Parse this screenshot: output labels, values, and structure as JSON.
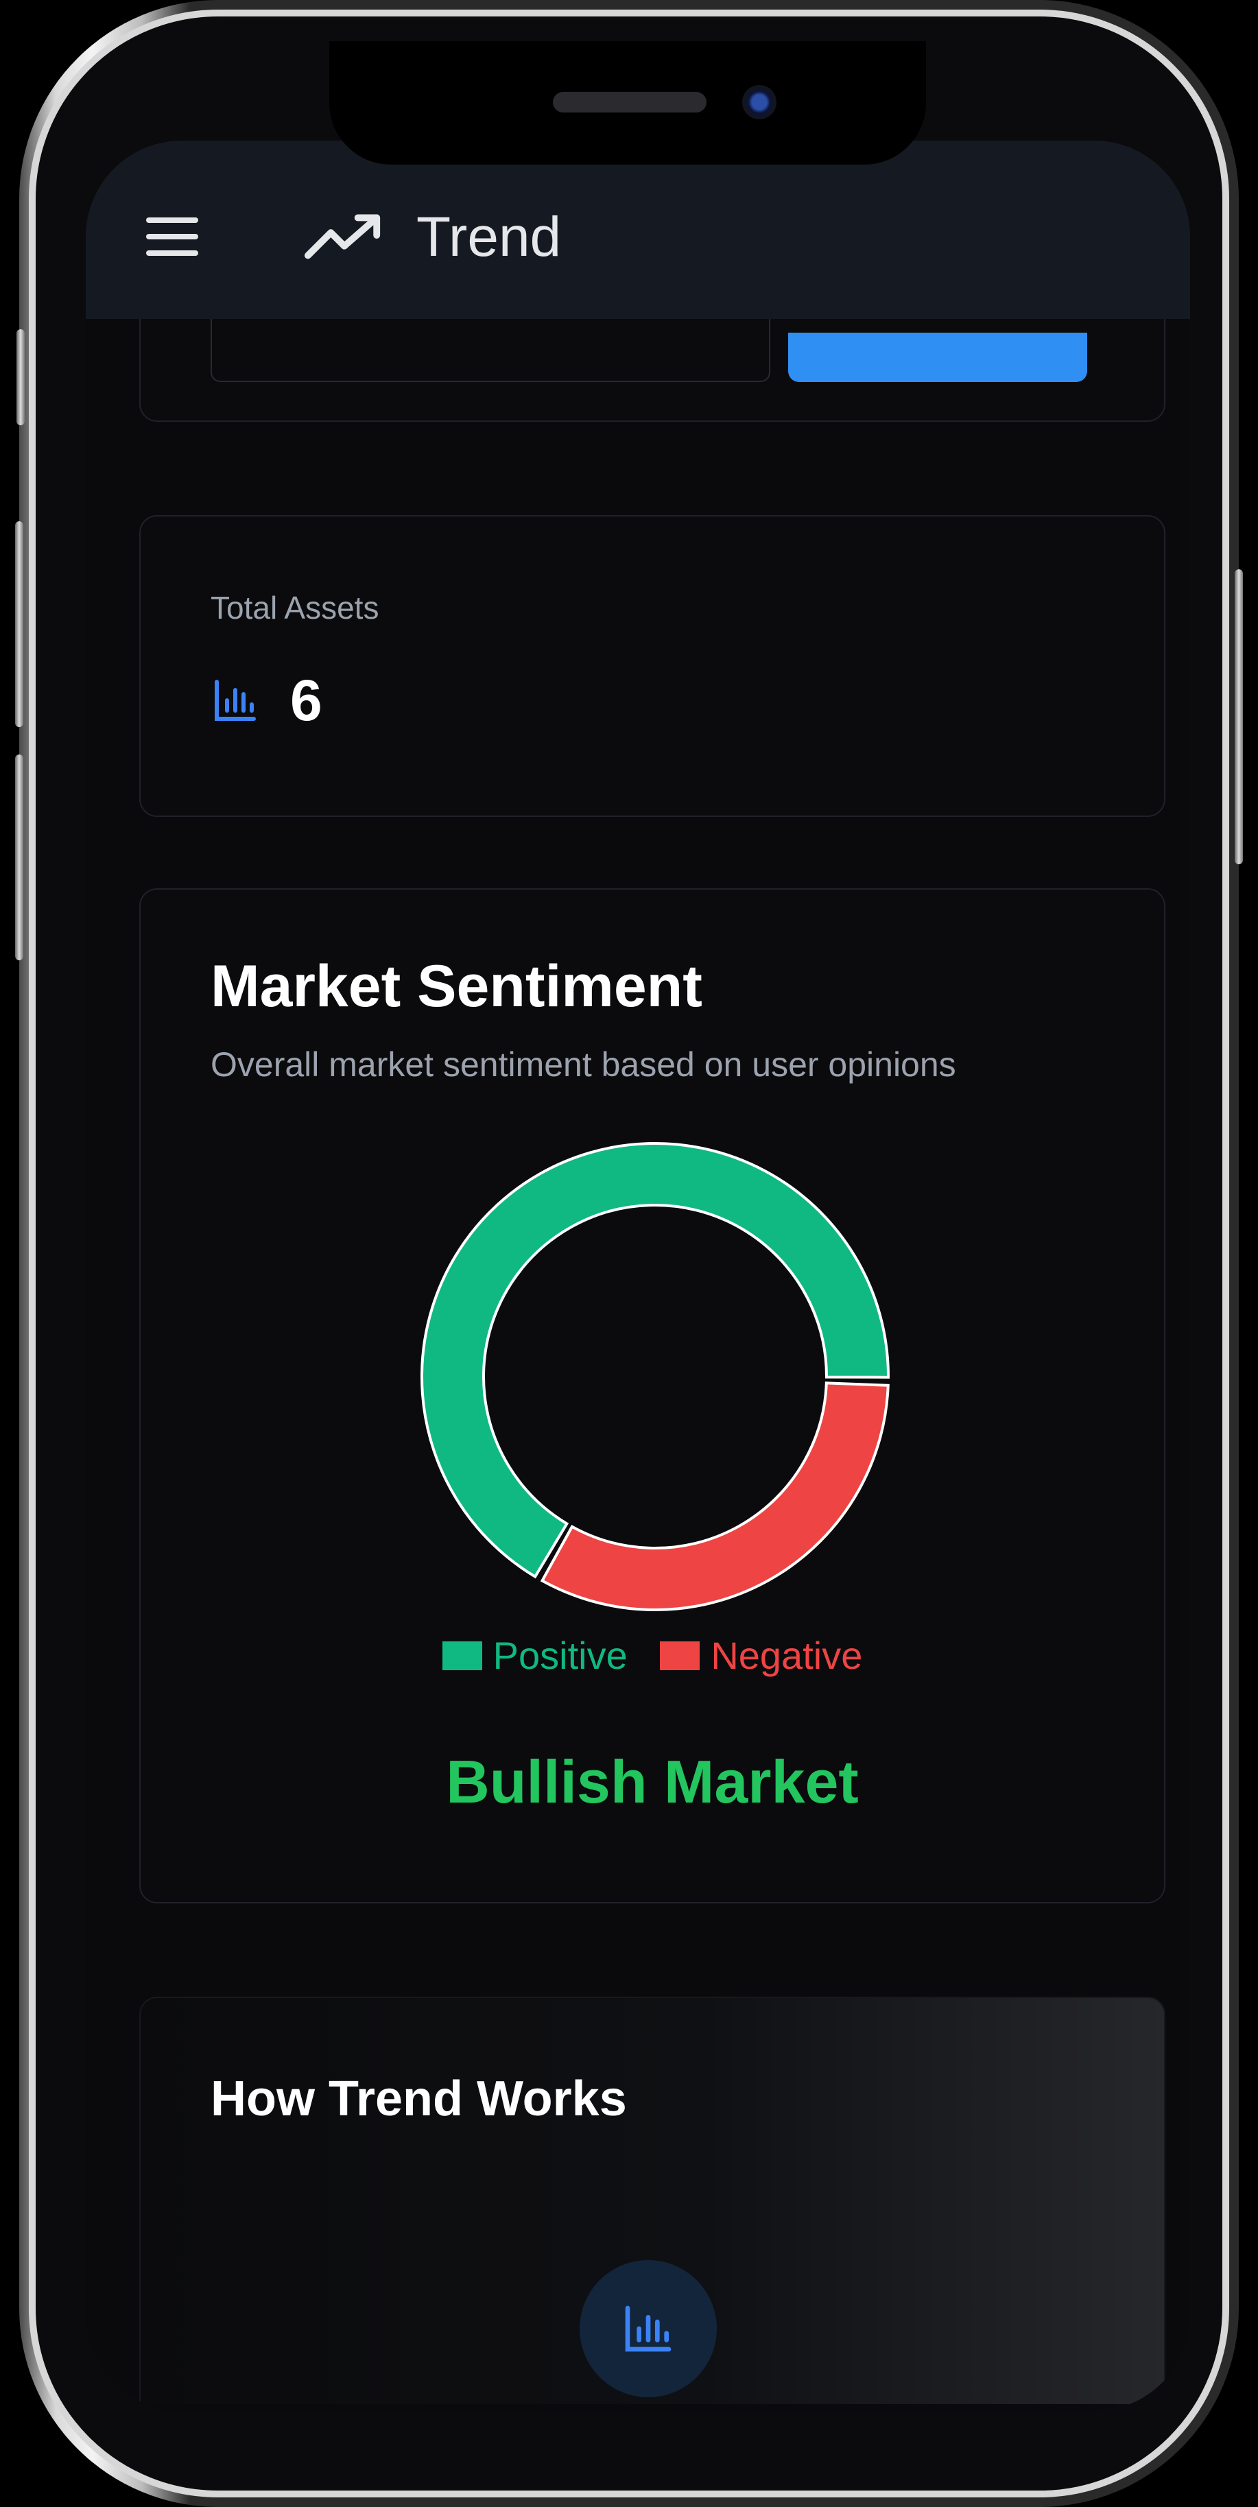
{
  "app": {
    "title": "Trend"
  },
  "header": {
    "menu_icon": "hamburger-menu-icon",
    "brand_icon": "trending-up-icon"
  },
  "stats": {
    "total_assets_label": "Total Assets",
    "total_assets_value": "6",
    "icon": "bar-chart-icon"
  },
  "sentiment": {
    "title": "Market Sentiment",
    "subtitle": "Overall market sentiment based on user opinions",
    "verdict": "Bullish Market",
    "verdict_color": "#22c55e"
  },
  "how_it_works": {
    "title": "How Trend Works"
  },
  "fab": {
    "icon": "bar-chart-icon"
  },
  "colors": {
    "positive": "#10b981",
    "negative": "#ef4444",
    "accent": "#2f8ff2",
    "header_bg": "#151a22"
  },
  "chart_data": {
    "type": "pie",
    "title": "",
    "categories": [
      "Positive",
      "Negative"
    ],
    "values": [
      67,
      33
    ],
    "colors": [
      "#10b981",
      "#ef4444"
    ],
    "legend_position": "bottom"
  }
}
